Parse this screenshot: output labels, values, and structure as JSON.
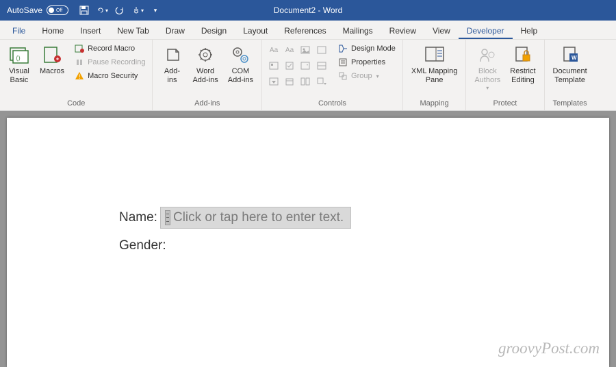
{
  "titlebar": {
    "autosave_label": "AutoSave",
    "autosave_state": "Off",
    "document_title": "Document2  - Word"
  },
  "tabs": [
    "File",
    "Home",
    "Insert",
    "New Tab",
    "Draw",
    "Design",
    "Layout",
    "References",
    "Mailings",
    "Review",
    "View",
    "Developer",
    "Help"
  ],
  "active_tab": "Developer",
  "ribbon": {
    "code": {
      "label": "Code",
      "visual_basic": "Visual\nBasic",
      "macros": "Macros",
      "record_macro": "Record Macro",
      "pause_recording": "Pause Recording",
      "macro_security": "Macro Security"
    },
    "addins": {
      "label": "Add-ins",
      "addins_btn": "Add-\nins",
      "word_addins": "Word\nAdd-ins",
      "com_addins": "COM\nAdd-ins"
    },
    "controls": {
      "label": "Controls",
      "design_mode": "Design Mode",
      "properties": "Properties",
      "group": "Group"
    },
    "mapping": {
      "label": "Mapping",
      "xml_pane": "XML Mapping\nPane"
    },
    "protect": {
      "label": "Protect",
      "block_authors": "Block\nAuthors",
      "restrict_editing": "Restrict\nEditing"
    },
    "templates": {
      "label": "Templates",
      "doc_template": "Document\nTemplate"
    }
  },
  "document": {
    "name_label": "Name:",
    "name_placeholder": "Click or tap here to enter text.",
    "gender_label": "Gender:"
  },
  "watermark": "groovyPost.com"
}
